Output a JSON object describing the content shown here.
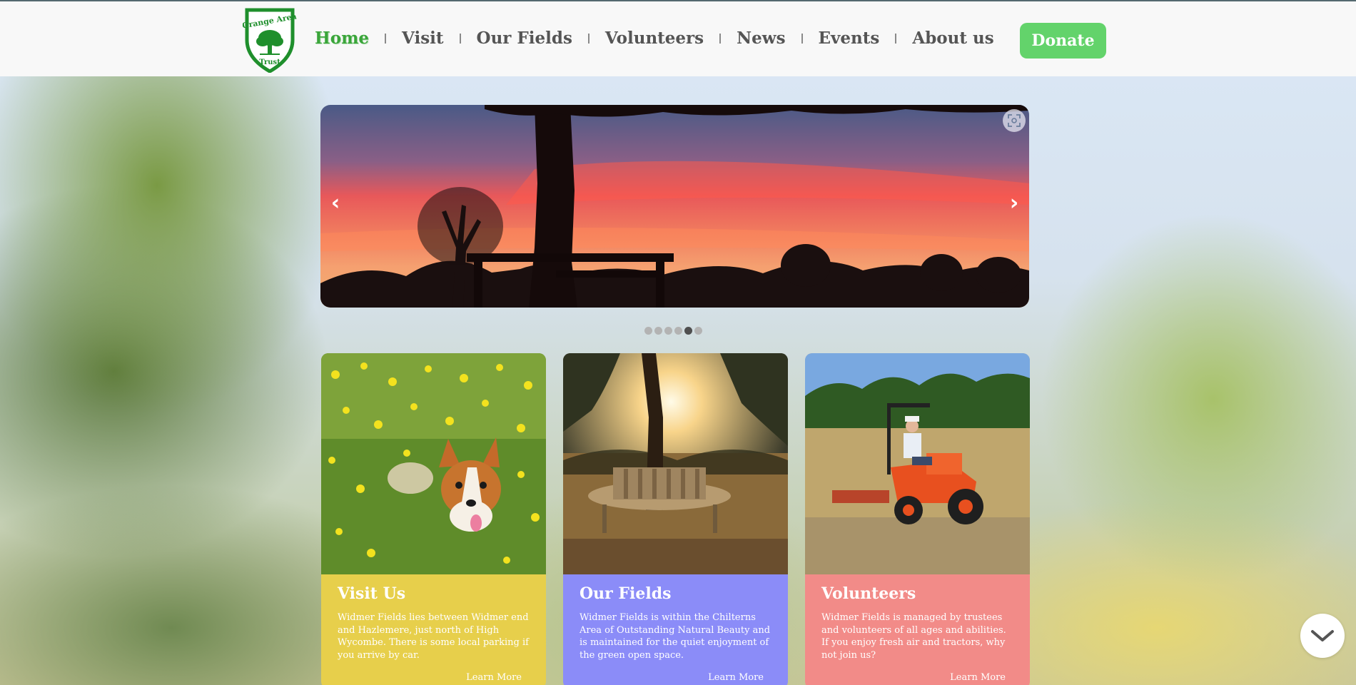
{
  "header": {
    "logo_text_top": "Grange Area",
    "logo_text_bottom": "Trust",
    "nav": [
      {
        "label": "Home",
        "active": true
      },
      {
        "label": "Visit"
      },
      {
        "label": "Our Fields"
      },
      {
        "label": "Volunteers"
      },
      {
        "label": "News"
      },
      {
        "label": "Events"
      },
      {
        "label": "About us"
      }
    ],
    "donate_label": "Donate"
  },
  "carousel": {
    "prev_label": "‹",
    "next_label": "›",
    "slide_count": 6,
    "active_slide": 5,
    "icons": {
      "fullscreen": "fullscreen-icon"
    }
  },
  "cards": [
    {
      "title": "Visit Us",
      "text": "Widmer Fields lies between Widmer end and Hazlemere, just north of High Wycombe. There is some local parking if you arrive by car.",
      "link": "Learn More",
      "color": "#e7cf4b"
    },
    {
      "title": "Our Fields",
      "text": "Widmer Fields is within the Chilterns Area of Outstanding Natural Beauty and is maintained for the quiet enjoyment of the green open space.",
      "link": "Learn More",
      "color": "#8b8cf8"
    },
    {
      "title": "Volunteers",
      "text": "Widmer Fields is managed by trustees and volunteers of all ages and abilities. If you enjoy fresh air and tractors, why not join us?",
      "link": "Learn More",
      "color": "#f28b88"
    }
  ],
  "colors": {
    "brand_green": "#3aa53a",
    "donate_green": "#63d36b"
  },
  "icons": {
    "scroll_down": "chevron-down-icon"
  }
}
